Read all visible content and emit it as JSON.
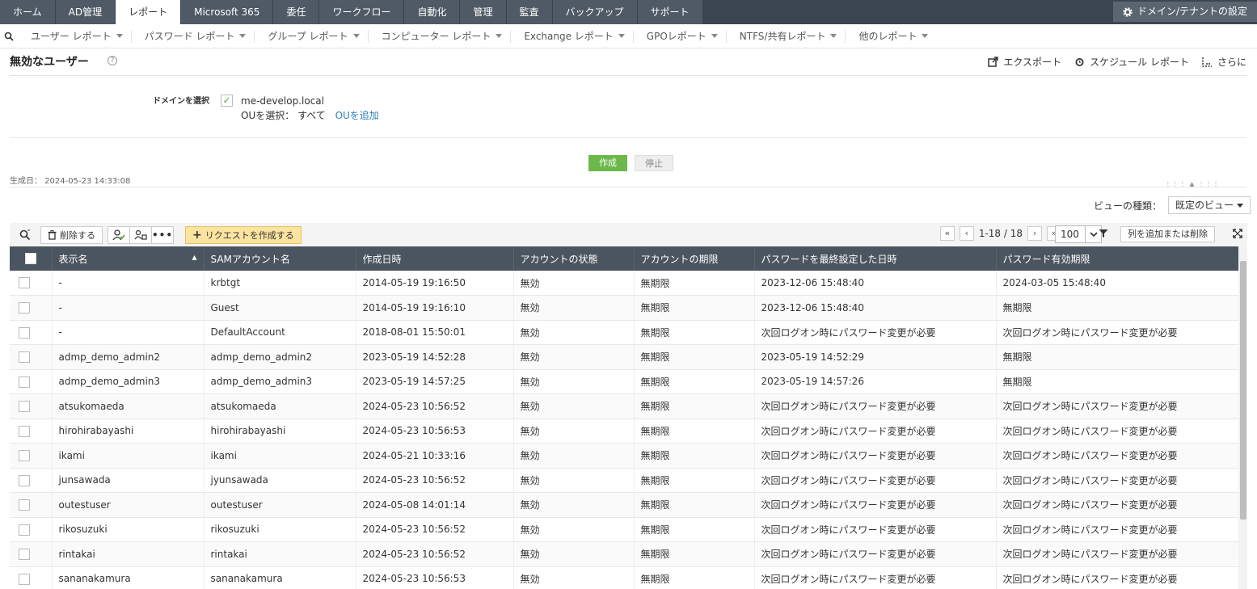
{
  "topnav": {
    "tabs": [
      {
        "label": "ホーム"
      },
      {
        "label": "AD管理"
      },
      {
        "label": "レポート",
        "active": true
      },
      {
        "label": "Microsoft 365"
      },
      {
        "label": "委任"
      },
      {
        "label": "ワークフロー"
      },
      {
        "label": "自動化"
      },
      {
        "label": "管理"
      },
      {
        "label": "監査"
      },
      {
        "label": "バックアップ"
      },
      {
        "label": "サポート"
      }
    ],
    "domain_settings": "ドメイン/テナントの設定"
  },
  "subnav": {
    "items": [
      "ユーザー レポート",
      "パスワード レポート",
      "グループ レポート",
      "コンピューター レポート",
      "Exchange レポート",
      "GPOレポート",
      "NTFS/共有レポート",
      "他のレポート"
    ]
  },
  "page": {
    "title": "無効なユーザー",
    "help": "?",
    "actions": {
      "export": "エクスポート",
      "schedule": "スケジュール レポート",
      "more": "さらに"
    }
  },
  "domain": {
    "label": "ドメインを選択",
    "name": "me-develop.local",
    "ou_label": "OUを選択：",
    "ou_value": "すべて",
    "ou_add": "OUを追加"
  },
  "generate": {
    "create": "作成",
    "stop": "停止",
    "generated_on": "生成日：  2024-05-23 14:33:08"
  },
  "view": {
    "label": "ビューの種類：",
    "selected": "既定のビュー"
  },
  "toolbar": {
    "delete": "削除する",
    "request": "リクエストを作成する",
    "pager": "1-18 / 18",
    "per_page": "100",
    "add_remove_cols": "列を追加または削除"
  },
  "table": {
    "columns": [
      "表示名",
      "SAMアカウント名",
      "作成日時",
      "アカウントの状態",
      "アカウントの期限",
      "パスワードを最終設定した日時",
      "パスワード有効期限"
    ],
    "rows": [
      [
        "-",
        "krbtgt",
        "2014-05-19 19:16:50",
        "無効",
        "無期限",
        "2023-12-06 15:48:40",
        "2024-03-05 15:48:40"
      ],
      [
        "-",
        "Guest",
        "2014-05-19 19:16:10",
        "無効",
        "無期限",
        "2023-12-06 15:48:40",
        "無期限"
      ],
      [
        "-",
        "DefaultAccount",
        "2018-08-01 15:50:01",
        "無効",
        "無期限",
        "次回ログオン時にパスワード変更が必要",
        "次回ログオン時にパスワード変更が必要"
      ],
      [
        "admp_demo_admin2",
        "admp_demo_admin2",
        "2023-05-19 14:52:28",
        "無効",
        "無期限",
        "2023-05-19 14:52:29",
        "無期限"
      ],
      [
        "admp_demo_admin3",
        "admp_demo_admin3",
        "2023-05-19 14:57:25",
        "無効",
        "無期限",
        "2023-05-19 14:57:26",
        "無期限"
      ],
      [
        "atsukomaeda",
        "atsukomaeda",
        "2024-05-23 10:56:52",
        "無効",
        "無期限",
        "次回ログオン時にパスワード変更が必要",
        "次回ログオン時にパスワード変更が必要"
      ],
      [
        "hirohirabayashi",
        "hirohirabayashi",
        "2024-05-23 10:56:53",
        "無効",
        "無期限",
        "次回ログオン時にパスワード変更が必要",
        "次回ログオン時にパスワード変更が必要"
      ],
      [
        "ikami",
        "ikami",
        "2024-05-21 10:33:16",
        "無効",
        "無期限",
        "次回ログオン時にパスワード変更が必要",
        "次回ログオン時にパスワード変更が必要"
      ],
      [
        "junsawada",
        "jyunsawada",
        "2024-05-23 10:56:52",
        "無効",
        "無期限",
        "次回ログオン時にパスワード変更が必要",
        "次回ログオン時にパスワード変更が必要"
      ],
      [
        "outestuser",
        "outestuser",
        "2024-05-08 14:01:14",
        "無効",
        "無期限",
        "次回ログオン時にパスワード変更が必要",
        "次回ログオン時にパスワード変更が必要"
      ],
      [
        "rikosuzuki",
        "rikosuzuki",
        "2024-05-23 10:56:52",
        "無効",
        "無期限",
        "次回ログオン時にパスワード変更が必要",
        "次回ログオン時にパスワード変更が必要"
      ],
      [
        "rintakai",
        "rintakai",
        "2024-05-23 10:56:52",
        "無効",
        "無期限",
        "次回ログオン時にパスワード変更が必要",
        "次回ログオン時にパスワード変更が必要"
      ],
      [
        "sananakamura",
        "sananakamura",
        "2024-05-23 10:56:53",
        "無効",
        "無期限",
        "次回ログオン時にパスワード変更が必要",
        "次回ログオン時にパスワード変更が必要"
      ]
    ]
  },
  "icons": {
    "search": "search-icon",
    "gear": "gear-icon",
    "export": "export-icon",
    "schedule": "alarm-clock-icon",
    "more": "more-icon",
    "trash": "trash-icon",
    "filter": "filter-icon",
    "expand": "expand-icon"
  },
  "colors": {
    "nav_bg": "#3c4650",
    "header_bg": "#4b5560",
    "create_green": "#6cb84a",
    "request_yellow": "#fbe3a0",
    "link_blue": "#2f7fb8"
  }
}
